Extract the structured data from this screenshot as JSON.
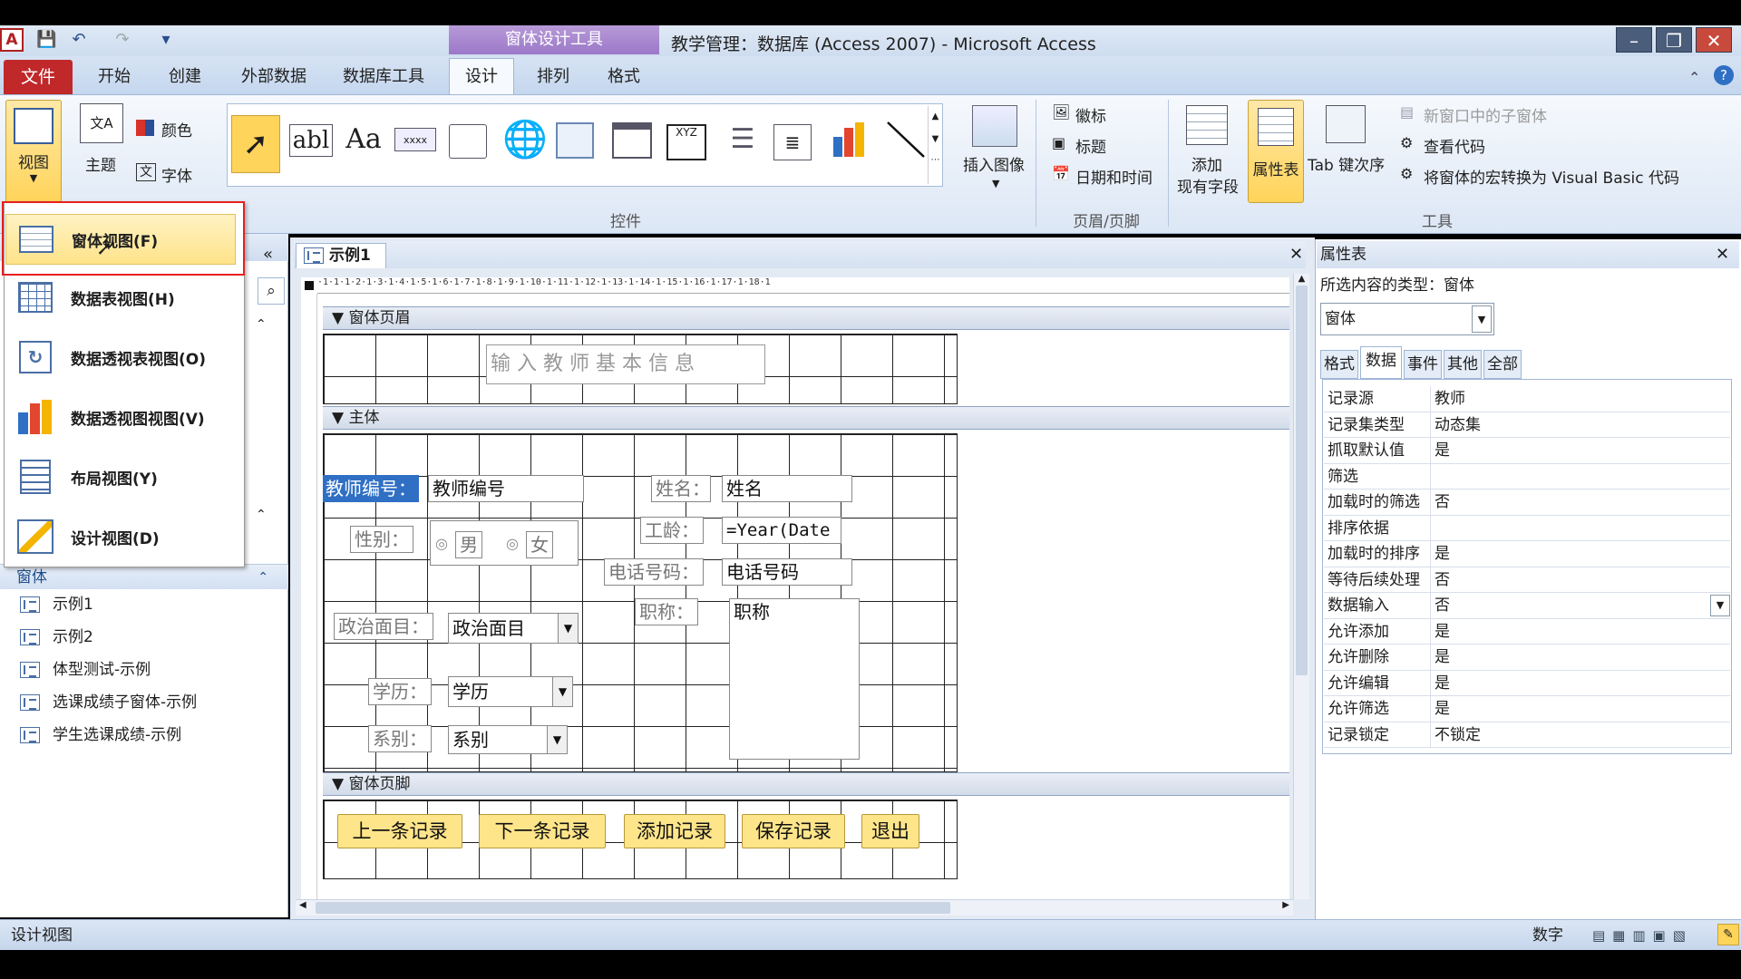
{
  "window": {
    "title": "教学管理：数据库 (Access 2007) - Microsoft Access",
    "context_tab_group": "窗体设计工具",
    "app_icon": "A",
    "controls": [
      "minimize-icon",
      "restore-icon",
      "close-icon"
    ]
  },
  "ribbon_tabs": [
    "文件",
    "开始",
    "创建",
    "外部数据",
    "数据库工具",
    "设计",
    "排列",
    "格式"
  ],
  "active_tab": "设计",
  "ribbon": {
    "view_label": "视图",
    "theme_label": "主题",
    "colors_label": "颜色",
    "fonts_label": "字体",
    "controls_group": "控件",
    "insert_image": "插入图像",
    "logo": "徽标",
    "title": "标题",
    "datetime": "日期和时间",
    "header_footer_group": "页眉/页脚",
    "add_fields_1": "添加",
    "add_fields_2": "现有字段",
    "property_sheet": "属性表",
    "tab_order": "Tab 键次序",
    "subform": "新窗口中的子窗体",
    "view_code": "查看代码",
    "convert_macros": "将窗体的宏转换为 Visual Basic 代码",
    "tools_group": "工具",
    "gallery_xyz": "XYZ",
    "gallery_textbox": "abl",
    "gallery_label": "Aa",
    "gallery_button": "xxxx"
  },
  "view_menu": [
    {
      "label": "窗体视图(F)",
      "icon": "form-view-icon",
      "selected": true
    },
    {
      "label": "数据表视图(H)",
      "icon": "datasheet-view-icon"
    },
    {
      "label": "数据透视表视图(O)",
      "icon": "pivot-table-icon"
    },
    {
      "label": "数据透视图视图(V)",
      "icon": "pivot-chart-icon"
    },
    {
      "label": "布局视图(Y)",
      "icon": "layout-view-icon"
    },
    {
      "label": "设计视图(D)",
      "icon": "design-view-icon"
    }
  ],
  "nav": {
    "group": "窗体",
    "items": [
      "示例1",
      "示例2",
      "体型测试-示例",
      "选课成绩子窗体-示例",
      "学生选课成绩-示例"
    ]
  },
  "document": {
    "tab": "示例1",
    "ruler": "·1·1·1·2·1·3·1·4·1·5·1·6·1·7·1·8·1·9·1·10·1·11·1·12·1·13·1·14·1·15·1·16·1·17·1·18·1",
    "sections": {
      "header": "窗体页眉",
      "detail": "主体",
      "footer": "窗体页脚"
    },
    "header_title": "输入教师基本信息",
    "fields": {
      "teacher_id_label": "教师编号：",
      "teacher_id": "教师编号",
      "name_label": "姓名：",
      "name": "姓名",
      "gender_label": "性别：",
      "male": "男",
      "female": "女",
      "age_label": "工龄：",
      "age": "=Year(Date",
      "phone_label": "电话号码：",
      "phone": "电话号码",
      "politics_label": "政治面目：",
      "politics": "政治面目",
      "title_label": "职称：",
      "title": "职称",
      "edu_label": "学历：",
      "edu": "学历",
      "dept_label": "系别：",
      "dept": "系别"
    },
    "buttons": [
      "上一条记录",
      "下一条记录",
      "添加记录",
      "保存记录",
      "退出"
    ]
  },
  "property_sheet": {
    "title": "属性表",
    "selection_type": "所选内容的类型：窗体",
    "selected_object": "窗体",
    "tabs": [
      "格式",
      "数据",
      "事件",
      "其他",
      "全部"
    ],
    "active_tab": "数据",
    "rows": [
      {
        "k": "记录源",
        "v": "教师"
      },
      {
        "k": "记录集类型",
        "v": "动态集"
      },
      {
        "k": "抓取默认值",
        "v": "是"
      },
      {
        "k": "筛选",
        "v": ""
      },
      {
        "k": "加载时的筛选",
        "v": "否"
      },
      {
        "k": "排序依据",
        "v": ""
      },
      {
        "k": "加载时的排序",
        "v": "是"
      },
      {
        "k": "等待后续处理",
        "v": "否"
      },
      {
        "k": "数据输入",
        "v": "否"
      },
      {
        "k": "允许添加",
        "v": "是"
      },
      {
        "k": "允许删除",
        "v": "是"
      },
      {
        "k": "允许编辑",
        "v": "是"
      },
      {
        "k": "允许筛选",
        "v": "是"
      },
      {
        "k": "记录锁定",
        "v": "不锁定"
      }
    ]
  },
  "status": {
    "left": "设计视图",
    "right": "数字"
  }
}
